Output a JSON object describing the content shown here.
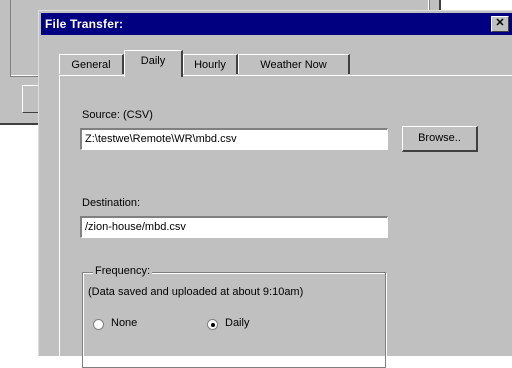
{
  "dialog": {
    "title": "File Transfer:",
    "close_glyph": "✕"
  },
  "tabs": [
    {
      "label": "General",
      "active": false
    },
    {
      "label": "Daily",
      "active": true
    },
    {
      "label": "Hourly",
      "active": false
    },
    {
      "label": "Weather Now",
      "active": false
    }
  ],
  "source": {
    "label": "Source: (CSV)",
    "value": "Z:\\testwe\\Remote\\WR\\mbd.csv",
    "browse_label": "Browse.."
  },
  "destination": {
    "label": "Destination:",
    "value": "/zion-house/mbd.csv"
  },
  "frequency": {
    "legend": "Frequency:",
    "note": "(Data saved and uploaded at about 9:10am)",
    "options": [
      {
        "label": "None",
        "selected": false
      },
      {
        "label": "Daily",
        "selected": true
      }
    ]
  }
}
